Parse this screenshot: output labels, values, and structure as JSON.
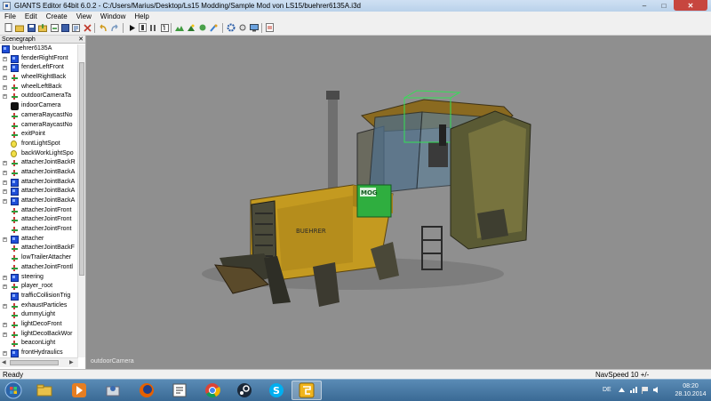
{
  "window": {
    "title": "GIANTS Editor 64bit 6.0.2 - C:/Users/Marius/Desktop/Ls15 Modding/Sample Mod von LS15/buehrer6135A.i3d",
    "minimize": "–",
    "maximize": "□",
    "close": "✕"
  },
  "menu": [
    "File",
    "Edit",
    "Create",
    "View",
    "Window",
    "Help"
  ],
  "scenegraph": {
    "title": "Scenegraph",
    "close": "✕",
    "items": [
      {
        "label": "buehrer6135A",
        "icon": "tg",
        "indent": 0
      },
      {
        "label": "fenderRightFront",
        "icon": "tg",
        "indent": 1,
        "expand": "+"
      },
      {
        "label": "fenderLeftFront",
        "icon": "tg",
        "indent": 1,
        "expand": "+"
      },
      {
        "label": "wheelRightBack",
        "icon": "ax",
        "indent": 1,
        "expand": "+"
      },
      {
        "label": "wheelLeftBack",
        "icon": "ax",
        "indent": 1,
        "expand": "+"
      },
      {
        "label": "outdoorCameraTa",
        "icon": "ax",
        "indent": 1,
        "expand": "+"
      },
      {
        "label": "indoorCamera",
        "icon": "cam",
        "indent": 1
      },
      {
        "label": "cameraRaycastNo",
        "icon": "ax",
        "indent": 1
      },
      {
        "label": "cameraRaycastNo",
        "icon": "ax",
        "indent": 1
      },
      {
        "label": "exitPoint",
        "icon": "ax",
        "indent": 1
      },
      {
        "label": "frontLightSpot",
        "icon": "lt",
        "indent": 1
      },
      {
        "label": "backWorkLightSpo",
        "icon": "lt",
        "indent": 1
      },
      {
        "label": "attacherJointBackR",
        "icon": "ax",
        "indent": 1,
        "expand": "+"
      },
      {
        "label": "attacherJointBackA",
        "icon": "ax",
        "indent": 1,
        "expand": "+"
      },
      {
        "label": "attacherJointBackA",
        "icon": "tg",
        "indent": 1,
        "expand": "+"
      },
      {
        "label": "attacherJointBackA",
        "icon": "tg",
        "indent": 1,
        "expand": "+"
      },
      {
        "label": "attacherJointBackA",
        "icon": "tg",
        "indent": 1,
        "expand": "+"
      },
      {
        "label": "attacherJointFront",
        "icon": "ax",
        "indent": 1
      },
      {
        "label": "attacherJointFront",
        "icon": "ax",
        "indent": 1
      },
      {
        "label": "attacherJointFront",
        "icon": "ax",
        "indent": 1
      },
      {
        "label": "attacher",
        "icon": "tg",
        "indent": 1,
        "expand": "+"
      },
      {
        "label": "attacherJointBackF",
        "icon": "ax",
        "indent": 1
      },
      {
        "label": "lowTrailerAttacher",
        "icon": "ax",
        "indent": 1
      },
      {
        "label": "attacherJointFrontl",
        "icon": "ax",
        "indent": 1
      },
      {
        "label": "steering",
        "icon": "tg",
        "indent": 1,
        "expand": "+"
      },
      {
        "label": "player_root",
        "icon": "ax",
        "indent": 1,
        "expand": "+"
      },
      {
        "label": "trafficCollisionTrig",
        "icon": "tg",
        "indent": 1
      },
      {
        "label": "exhaustParticles",
        "icon": "ax",
        "indent": 1,
        "expand": "+"
      },
      {
        "label": "dummyLight",
        "icon": "ax",
        "indent": 1
      },
      {
        "label": "lightDecoFront",
        "icon": "ax",
        "indent": 1,
        "expand": "+"
      },
      {
        "label": "lightDecoBackWor",
        "icon": "ax",
        "indent": 1,
        "expand": "+"
      },
      {
        "label": "beaconLight",
        "icon": "ax",
        "indent": 1
      },
      {
        "label": "frontHydraulics",
        "icon": "tg",
        "indent": 1,
        "expand": "+"
      }
    ]
  },
  "viewport": {
    "camera_label": "outdoorCamera",
    "brand_decal": "MOG",
    "hood_text": "BUEHRER"
  },
  "statusbar": {
    "left": "Ready",
    "right": "NavSpeed 10 +/-"
  },
  "taskbar": {
    "apps": [
      "start-orb",
      "file-explorer",
      "media-player",
      "user-app",
      "firefox",
      "editor-app",
      "chrome",
      "steam",
      "skype",
      "giants-editor"
    ],
    "lang": "DE",
    "time": "08:20",
    "date": "28.10.2014"
  },
  "colors": {
    "viewport_bg": "#8f8f8f",
    "tractor_yellow": "#c49a20",
    "taskbar": "#3a6a95"
  }
}
